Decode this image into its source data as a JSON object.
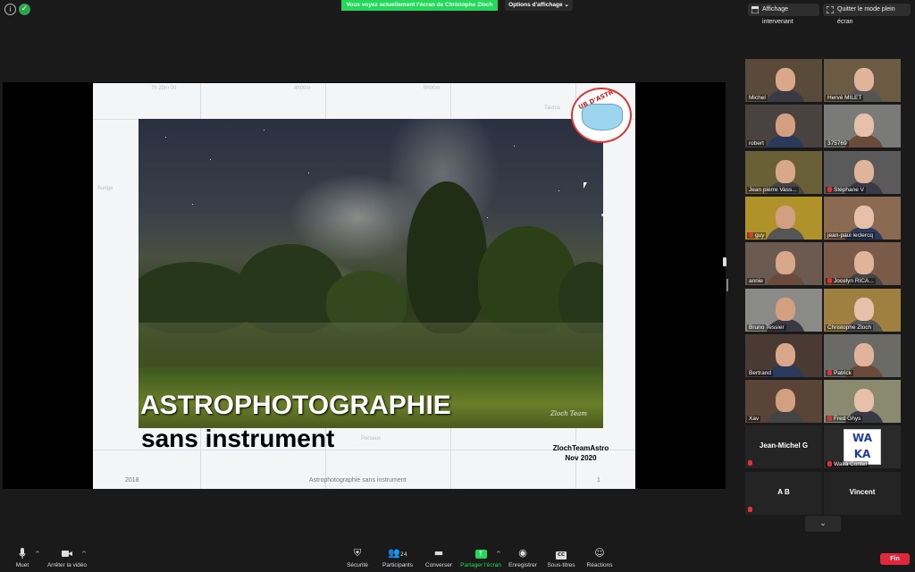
{
  "top_bar": {
    "share_banner": "Vous voyez actuellement l'écran de Christophe Zloch",
    "view_options": "Options d'affichage",
    "speaker_view": "Affichage intervenant",
    "exit_fullscreen": "Quitter le mode plein écran"
  },
  "slide": {
    "title_line1": "ASTROPHOTOGRAPHIE",
    "title_line2": "sans instrument",
    "credit_team": "ZlochTeamAstro",
    "credit_date": "Nov 2020",
    "photo_signature": "Zloch Team",
    "footer_year": "2018",
    "footer_title": "Astrophotographie sans instrument",
    "footer_page": "1",
    "logo_text": "UB D'ASTRONO",
    "chart_labels": [
      "7h 20m 00",
      "4h00m",
      "5h00m",
      "Taurus",
      "Auriga",
      "Perseus"
    ]
  },
  "participants": [
    {
      "name": "Michel",
      "muted": false
    },
    {
      "name": "Hervé MILET",
      "muted": false
    },
    {
      "name": "robert",
      "muted": false
    },
    {
      "name": "375769",
      "muted": false
    },
    {
      "name": "Jean pierre Vass...",
      "muted": false,
      "active": true
    },
    {
      "name": "Stéphane V",
      "muted": true
    },
    {
      "name": "guy",
      "muted": true
    },
    {
      "name": "jean-paul leclercq",
      "muted": false
    },
    {
      "name": "annie",
      "muted": false
    },
    {
      "name": "Jocelyn RICA...",
      "muted": true
    },
    {
      "name": "Bruno Tessier",
      "muted": false
    },
    {
      "name": "Christophe Zloch",
      "muted": false
    },
    {
      "name": "Bertrand",
      "muted": false
    },
    {
      "name": "Patrick",
      "muted": true
    },
    {
      "name": "Xav",
      "muted": false
    },
    {
      "name": "Fred Ghys",
      "muted": true
    },
    {
      "name": "Jean-Michel G",
      "muted": true,
      "video_off": true
    },
    {
      "name": "Waka Contel",
      "muted": true,
      "logo": "WAKA"
    },
    {
      "name": "A B",
      "muted": true,
      "video_off": true
    },
    {
      "name": "Vincent",
      "muted": false,
      "video_off": true
    }
  ],
  "toolbar": {
    "mute": "Muet",
    "stop_video": "Arrêter la vidéo",
    "security": "Sécurité",
    "participants": "Participants",
    "participants_count": "24",
    "chat": "Converser",
    "share_screen": "Partager l'écran",
    "record": "Enregistrer",
    "subtitles": "Sous-titres",
    "cc_icon": "CC",
    "reactions": "Réactions",
    "end": "Fin"
  },
  "colors": {
    "accent_green": "#23d959",
    "end_red": "#e0283a",
    "active_speaker": "#c8e64a",
    "muted_red": "#e0303a"
  },
  "icons": [
    "info-icon",
    "shield-icon",
    "grid-icon",
    "expand-icon",
    "microphone-icon",
    "video-camera-icon",
    "security-icon",
    "participants-icon",
    "chat-icon",
    "share-screen-icon",
    "record-icon",
    "cc-icon",
    "reactions-icon",
    "chevron-down-icon"
  ]
}
